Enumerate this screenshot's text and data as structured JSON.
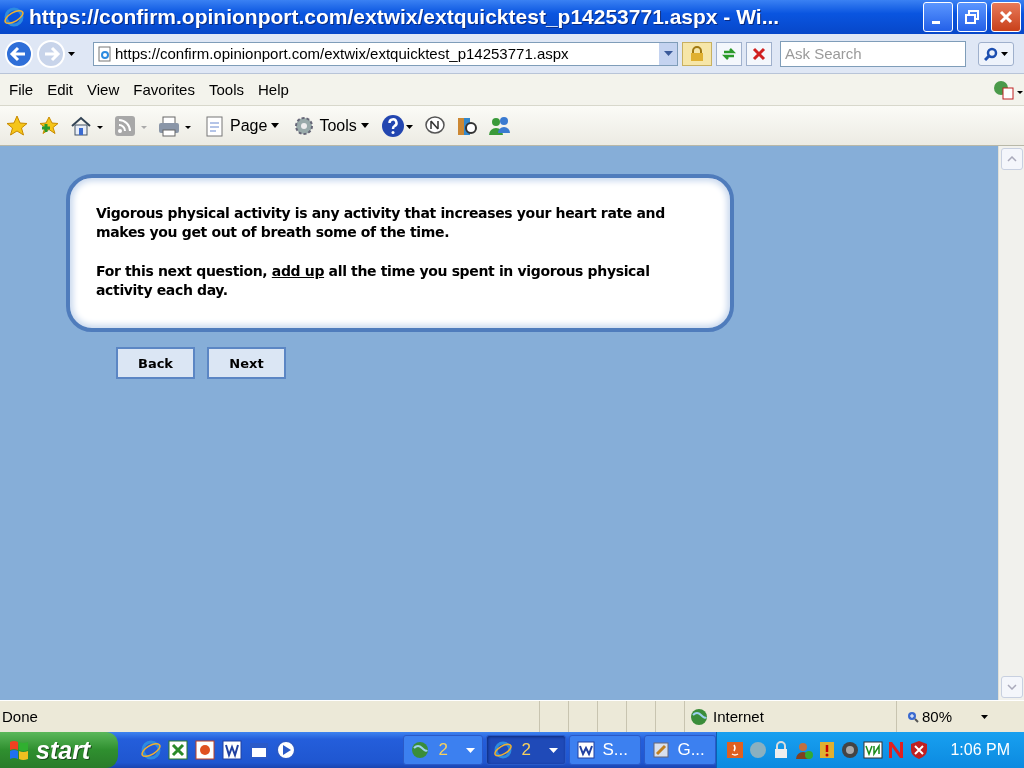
{
  "window": {
    "title": "https://confirm.opinionport.com/extwix/extquicktest_p14253771.aspx - Wi..."
  },
  "address_bar": {
    "url": "https://confirm.opinionport.com/extwix/extquicktest_p14253771.aspx",
    "search_placeholder": "Ask Search"
  },
  "menu_bar": [
    "File",
    "Edit",
    "View",
    "Favorites",
    "Tools",
    "Help"
  ],
  "command_bar": [
    {
      "kind": "page",
      "label": "Page"
    },
    {
      "kind": "tools",
      "label": "Tools"
    }
  ],
  "page": {
    "paragraphs": [
      {
        "before": "Vigorous physical activity is any activity that increases your heart rate and makes you get out of breath some of the time."
      },
      {
        "before": "For this next question, ",
        "underlined": "add up",
        "after": " all the time you spent in vigorous physical activity each day."
      }
    ],
    "buttons": [
      "Back",
      "Next"
    ]
  },
  "status_bar": {
    "status": "Done",
    "zone": "Internet",
    "zoom": "80%"
  },
  "taskbar": {
    "start": "start",
    "groups": [
      {
        "kind": "globe",
        "count": "2",
        "selected": false
      },
      {
        "kind": "ie",
        "count": "2",
        "selected": true
      }
    ],
    "tasks": [
      {
        "kind": "word",
        "label": "S..."
      },
      {
        "kind": "paint",
        "label": "G..."
      }
    ],
    "clock": "1:06 PM"
  }
}
